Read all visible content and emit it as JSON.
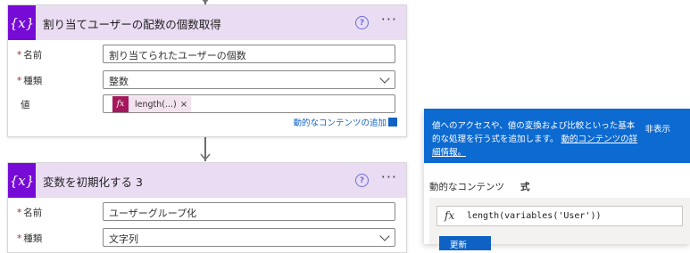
{
  "card1": {
    "icon_label": "{x}",
    "title": "割り当てユーザーの配数の個数取得",
    "help": "?",
    "more": "···",
    "fields": {
      "name_label": "名前",
      "name_value": "割り当てられたユーザーの個数",
      "type_label": "種類",
      "type_value": "整数",
      "value_label": "値",
      "token_icon": "fx",
      "token_label": "length(...)",
      "token_remove": "×"
    },
    "add_dynamic_content": "動的なコンテンツの追加"
  },
  "card2": {
    "icon_label": "{x}",
    "title": "変数を初期化する 3",
    "help": "?",
    "more": "···",
    "fields": {
      "name_label": "名前",
      "name_value": "ユーザーグループ化",
      "type_label": "種類",
      "type_value": "文字列"
    }
  },
  "required_marker": "*",
  "expression_panel": {
    "description": "値へのアクセスや、値の変換および比較といった基本的な処理を行う式を追加します。",
    "learn_more": "動的コンテンツの詳細情報。",
    "hide": "非表示",
    "tabs": [
      "動的なコンテンツ",
      "式"
    ],
    "active_tab": "式",
    "expression_icon": "fx",
    "expression": "length(variables('User'))",
    "update_button": "更新"
  },
  "colors": {
    "variable_icon": "#770bd6",
    "header_bg": "#eadcf3",
    "token_icon": "#a4195d",
    "panel_blue": "#0c6ad1",
    "link_blue": "#0f62c3"
  }
}
